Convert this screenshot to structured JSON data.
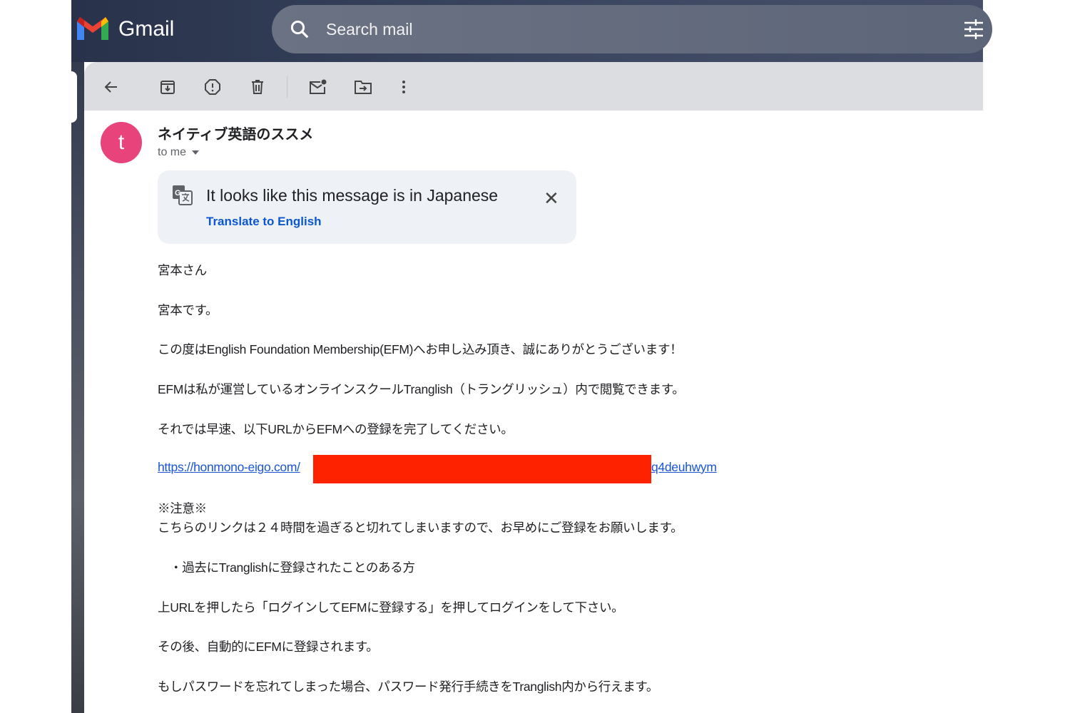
{
  "header": {
    "app_name": "Gmail",
    "search_placeholder": "Search mail"
  },
  "toolbar": {
    "icons": [
      "back-icon",
      "archive-icon",
      "report-spam-icon",
      "delete-icon",
      "mark-unread-icon",
      "move-to-icon",
      "more-icon"
    ]
  },
  "message": {
    "avatar_letter": "t",
    "sender": "ネイティブ英語のススメ",
    "recipient": "to me",
    "translate_banner": {
      "title": "It looks like this message is in Japanese",
      "action": "Translate to English"
    },
    "body": [
      "宮本さん",
      "宮本です。",
      "この度はEnglish Foundation Membership(EFM)へお申し込み頂き、誠にありがとうございます！",
      "EFMは私が運営しているオンラインスクールTranglish（トラングリッシュ）内で閲覧できます。",
      "それでは早速、以下URLからEFMへの登録を完了してください。"
    ],
    "link_start": "https://honmono-eigo.com/",
    "link_end": "q4deuhwym",
    "notice_title": "※注意※",
    "notice_text": "こちらのリンクは２４時間を過ぎると切れてしまいますので、お早めにご登録をお願いします。",
    "bullet": "・過去にTranglishに登録されたことのある方",
    "body2": [
      "上URLを押したら「ログインしてEFMに登録する」を押してログインをして下さい。",
      "その後、自動的にEFMに登録されます。",
      "もしパスワードを忘れてしまった場合、パスワード発行手続きをTranglish内から行えます。"
    ]
  },
  "colors": {
    "avatar": "#e8437b",
    "link": "#1a55d6",
    "redaction": "#ff2200"
  }
}
